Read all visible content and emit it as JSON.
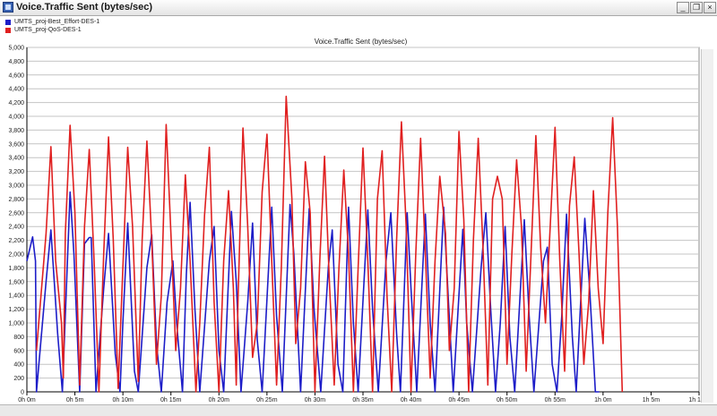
{
  "window": {
    "title": "Voice.Traffic Sent (bytes/sec)",
    "minimize_glyph": "_",
    "restore_glyph": "❐",
    "close_glyph": "×"
  },
  "colors": {
    "best_effort": "#1d1dc8",
    "qos": "#e02020",
    "grid": "#c4c4c4",
    "axis": "#000000"
  },
  "chart_data": {
    "type": "line",
    "title": "Voice.Traffic Sent (bytes/sec)",
    "xlabel": "",
    "ylabel": "",
    "ylim": [
      0,
      5000
    ],
    "xlim": [
      0,
      70
    ],
    "x_unit": "minutes",
    "y_ticks": [
      "0",
      "200",
      "400",
      "600",
      "800",
      "1,000",
      "1,200",
      "1,400",
      "1,600",
      "1,800",
      "2,000",
      "2,200",
      "2,400",
      "2,600",
      "2,800",
      "3,000",
      "3,200",
      "3,400",
      "3,600",
      "3,800",
      "4,000",
      "4,200",
      "4,400",
      "4,600",
      "4,800",
      "5,000"
    ],
    "x_ticks": [
      {
        "value": 0,
        "label": "0h 0m"
      },
      {
        "value": 5,
        "label": "0h 5m"
      },
      {
        "value": 10,
        "label": "0h 10m"
      },
      {
        "value": 15,
        "label": "0h 15m"
      },
      {
        "value": 20,
        "label": "0h 20m"
      },
      {
        "value": 25,
        "label": "0h 25m"
      },
      {
        "value": 30,
        "label": "0h 30m"
      },
      {
        "value": 35,
        "label": "0h 35m"
      },
      {
        "value": 40,
        "label": "0h 40m"
      },
      {
        "value": 45,
        "label": "0h 45m"
      },
      {
        "value": 50,
        "label": "0h 50m"
      },
      {
        "value": 55,
        "label": "0h 55m"
      },
      {
        "value": 60,
        "label": "1h 0m"
      },
      {
        "value": 65,
        "label": "1h 5m"
      },
      {
        "value": 70,
        "label": "1h 10m"
      }
    ],
    "grid": true,
    "legend_position": "top-left",
    "series": [
      {
        "name": "UMTS_proj-Best_Effort-DES-1",
        "color": "#1d1dc8",
        "points": [
          [
            0.0,
            1900
          ],
          [
            0.6,
            2250
          ],
          [
            0.9,
            1900
          ],
          [
            1.0,
            0
          ],
          [
            2.0,
            1600
          ],
          [
            2.5,
            2350
          ],
          [
            3.2,
            850
          ],
          [
            3.7,
            0
          ],
          [
            4.5,
            2900
          ],
          [
            4.9,
            2000
          ],
          [
            5.5,
            0
          ],
          [
            6.0,
            2150
          ],
          [
            6.5,
            2240
          ],
          [
            6.7,
            2240
          ],
          [
            7.2,
            0
          ],
          [
            8.0,
            1500
          ],
          [
            8.5,
            2300
          ],
          [
            9.2,
            550
          ],
          [
            9.7,
            0
          ],
          [
            10.0,
            1000
          ],
          [
            10.5,
            2450
          ],
          [
            11.2,
            300
          ],
          [
            11.6,
            0
          ],
          [
            12.5,
            1800
          ],
          [
            13.0,
            2280
          ],
          [
            13.5,
            700
          ],
          [
            14.0,
            0
          ],
          [
            14.6,
            1300
          ],
          [
            15.2,
            1900
          ],
          [
            15.6,
            1000
          ],
          [
            16.2,
            0
          ],
          [
            16.6,
            1700
          ],
          [
            17.0,
            2750
          ],
          [
            17.5,
            1200
          ],
          [
            18.0,
            0
          ],
          [
            19.0,
            1900
          ],
          [
            19.5,
            2400
          ],
          [
            20.0,
            600
          ],
          [
            20.5,
            0
          ],
          [
            21.3,
            2620
          ],
          [
            21.8,
            1600
          ],
          [
            22.3,
            0
          ],
          [
            23.0,
            1300
          ],
          [
            23.5,
            2450
          ],
          [
            24.0,
            750
          ],
          [
            24.5,
            0
          ],
          [
            25.5,
            2680
          ],
          [
            26.0,
            1100
          ],
          [
            26.6,
            0
          ],
          [
            27.4,
            2720
          ],
          [
            27.8,
            2000
          ],
          [
            28.5,
            0
          ],
          [
            29.4,
            2660
          ],
          [
            29.9,
            1200
          ],
          [
            30.6,
            0
          ],
          [
            31.4,
            1820
          ],
          [
            31.8,
            2350
          ],
          [
            32.4,
            400
          ],
          [
            32.9,
            0
          ],
          [
            33.5,
            2680
          ],
          [
            34.0,
            1000
          ],
          [
            34.5,
            0
          ],
          [
            35.5,
            2640
          ],
          [
            36.0,
            1200
          ],
          [
            36.6,
            0
          ],
          [
            37.4,
            1900
          ],
          [
            37.9,
            2600
          ],
          [
            38.5,
            850
          ],
          [
            38.9,
            0
          ],
          [
            39.6,
            2600
          ],
          [
            40.0,
            1500
          ],
          [
            40.6,
            0
          ],
          [
            41.5,
            2580
          ],
          [
            42.0,
            1000
          ],
          [
            42.5,
            0
          ],
          [
            43.4,
            2680
          ],
          [
            43.9,
            1300
          ],
          [
            44.4,
            0
          ],
          [
            45.4,
            2360
          ],
          [
            45.8,
            1000
          ],
          [
            46.4,
            0
          ],
          [
            47.3,
            1800
          ],
          [
            47.8,
            2600
          ],
          [
            48.3,
            1200
          ],
          [
            48.8,
            0
          ],
          [
            49.3,
            1000
          ],
          [
            49.8,
            2400
          ],
          [
            50.3,
            800
          ],
          [
            50.8,
            0
          ],
          [
            51.8,
            2500
          ],
          [
            52.3,
            1100
          ],
          [
            52.8,
            0
          ],
          [
            53.8,
            1900
          ],
          [
            54.2,
            2100
          ],
          [
            54.7,
            400
          ],
          [
            55.2,
            0
          ],
          [
            55.7,
            1100
          ],
          [
            56.2,
            2580
          ],
          [
            56.8,
            800
          ],
          [
            57.2,
            0
          ],
          [
            58.1,
            2520
          ],
          [
            58.6,
            1500
          ],
          [
            59.2,
            0
          ],
          [
            59.6,
            0
          ]
        ]
      },
      {
        "name": "UMTS_proj-QoS-DES-1",
        "color": "#e02020",
        "points": [
          [
            1.0,
            600
          ],
          [
            2.0,
            2300
          ],
          [
            2.5,
            3560
          ],
          [
            3.0,
            1900
          ],
          [
            3.6,
            1000
          ],
          [
            3.8,
            200
          ],
          [
            4.0,
            2300
          ],
          [
            4.5,
            3870
          ],
          [
            5.0,
            2600
          ],
          [
            5.5,
            100
          ],
          [
            6.0,
            2400
          ],
          [
            6.5,
            3520
          ],
          [
            7.0,
            1900
          ],
          [
            7.5,
            0
          ],
          [
            8.0,
            2000
          ],
          [
            8.5,
            3700
          ],
          [
            9.0,
            2200
          ],
          [
            9.5,
            50
          ],
          [
            10.0,
            1800
          ],
          [
            10.5,
            3550
          ],
          [
            11.0,
            2400
          ],
          [
            11.6,
            150
          ],
          [
            12.0,
            2200
          ],
          [
            12.5,
            3640
          ],
          [
            13.0,
            2200
          ],
          [
            13.5,
            400
          ],
          [
            14.0,
            1400
          ],
          [
            14.5,
            3880
          ],
          [
            15.0,
            2300
          ],
          [
            15.5,
            600
          ],
          [
            16.0,
            1500
          ],
          [
            16.5,
            3150
          ],
          [
            17.0,
            1900
          ],
          [
            17.6,
            0
          ],
          [
            18.0,
            1000
          ],
          [
            18.5,
            2560
          ],
          [
            19.0,
            3550
          ],
          [
            19.5,
            1300
          ],
          [
            20.0,
            0
          ],
          [
            20.5,
            1900
          ],
          [
            21.0,
            2920
          ],
          [
            21.5,
            1500
          ],
          [
            21.8,
            100
          ],
          [
            22.0,
            1400
          ],
          [
            22.5,
            3830
          ],
          [
            23.0,
            2400
          ],
          [
            23.5,
            500
          ],
          [
            24.0,
            1000
          ],
          [
            24.5,
            2900
          ],
          [
            25.0,
            3740
          ],
          [
            25.5,
            1900
          ],
          [
            26.0,
            100
          ],
          [
            26.5,
            1800
          ],
          [
            27.0,
            4290
          ],
          [
            27.6,
            2800
          ],
          [
            28.0,
            700
          ],
          [
            28.5,
            1500
          ],
          [
            29.0,
            3340
          ],
          [
            29.5,
            2600
          ],
          [
            30.0,
            0
          ],
          [
            30.5,
            1900
          ],
          [
            31.0,
            3420
          ],
          [
            31.5,
            1600
          ],
          [
            32.0,
            100
          ],
          [
            32.5,
            1800
          ],
          [
            33.0,
            3220
          ],
          [
            33.5,
            2000
          ],
          [
            34.0,
            0
          ],
          [
            34.5,
            1800
          ],
          [
            35.0,
            3540
          ],
          [
            35.5,
            1900
          ],
          [
            36.0,
            0
          ],
          [
            36.5,
            2800
          ],
          [
            37.0,
            3500
          ],
          [
            37.5,
            1400
          ],
          [
            38.0,
            0
          ],
          [
            38.5,
            2200
          ],
          [
            39.0,
            3920
          ],
          [
            39.5,
            2400
          ],
          [
            40.0,
            0
          ],
          [
            40.5,
            2000
          ],
          [
            41.0,
            3680
          ],
          [
            41.5,
            2000
          ],
          [
            42.0,
            200
          ],
          [
            42.5,
            1900
          ],
          [
            43.0,
            3130
          ],
          [
            43.6,
            2300
          ],
          [
            44.0,
            600
          ],
          [
            44.5,
            1500
          ],
          [
            45.0,
            3780
          ],
          [
            45.5,
            2500
          ],
          [
            46.0,
            0
          ],
          [
            46.5,
            2200
          ],
          [
            47.0,
            3680
          ],
          [
            47.5,
            2100
          ],
          [
            48.0,
            100
          ],
          [
            48.5,
            2800
          ],
          [
            49.0,
            3130
          ],
          [
            49.5,
            2800
          ],
          [
            50.0,
            400
          ],
          [
            50.5,
            2000
          ],
          [
            51.0,
            3370
          ],
          [
            51.5,
            2400
          ],
          [
            52.0,
            300
          ],
          [
            52.5,
            2000
          ],
          [
            53.0,
            3720
          ],
          [
            53.5,
            2100
          ],
          [
            54.0,
            1000
          ],
          [
            54.5,
            2400
          ],
          [
            55.0,
            3840
          ],
          [
            55.5,
            1900
          ],
          [
            56.0,
            300
          ],
          [
            56.5,
            2700
          ],
          [
            57.0,
            3410
          ],
          [
            57.5,
            2000
          ],
          [
            58.0,
            400
          ],
          [
            58.5,
            1300
          ],
          [
            59.0,
            2920
          ],
          [
            59.5,
            1500
          ],
          [
            60.0,
            700
          ],
          [
            60.5,
            2600
          ],
          [
            61.0,
            3980
          ],
          [
            61.5,
            2400
          ],
          [
            62.0,
            0
          ]
        ]
      }
    ]
  }
}
